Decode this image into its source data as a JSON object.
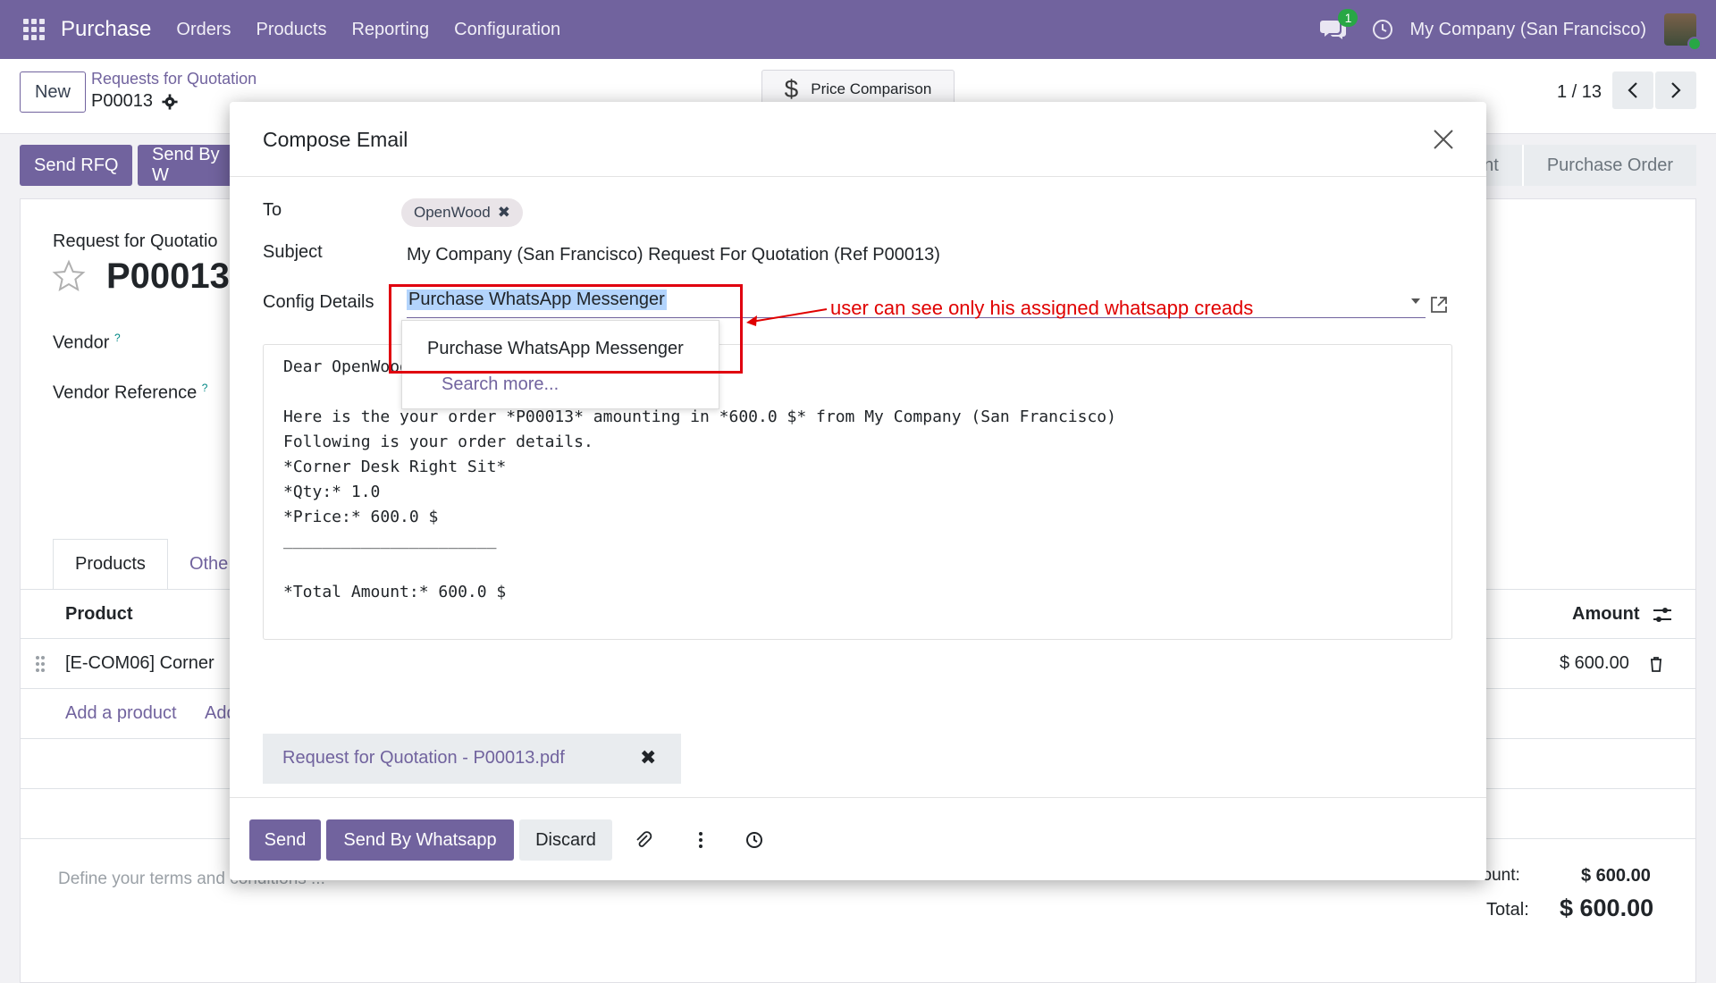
{
  "navbar": {
    "brand": "Purchase",
    "menu": [
      "Orders",
      "Products",
      "Reporting",
      "Configuration"
    ],
    "chat_badge": "1",
    "company": "My Company (San Francisco)"
  },
  "control": {
    "new_label": "New",
    "breadcrumb": "Requests for Quotation",
    "record": "P00013",
    "price_comparison": "Price Comparison",
    "dollar_glyph": "$",
    "pager": "1 / 13"
  },
  "form": {
    "send_rfq": "Send RFQ",
    "send_by": "Send By W",
    "status_left": "nt",
    "status_right": "Purchase Order",
    "label": "Request for Quotatio",
    "id": "P00013",
    "vendor_label": "Vendor",
    "vendor_ref_label": "Vendor Reference",
    "help": "?",
    "tabs": [
      "Products",
      "Othe"
    ],
    "col_product": "Product",
    "col_amount": "Amount",
    "row_product": "[E-COM06] Corner",
    "row_amount": "$ 600.00",
    "add_product": "Add a product",
    "add_section": "Add",
    "terms_placeholder": "Define your terms and conditions ...",
    "untaxed_label": "Untaxed Amount:",
    "untaxed_value": "$ 600.00",
    "total_label": "Total:",
    "total_value": "$ 600.00"
  },
  "modal": {
    "title": "Compose Email",
    "to_label": "To",
    "to_tag": "OpenWood",
    "tag_remove": "✖",
    "subject_label": "Subject",
    "subject": "My Company (San Francisco) Request For Quotation (Ref P00013)",
    "config_label": "Config Details",
    "config_value": "Purchase WhatsApp Messenger",
    "annotation": "user can see only his assigned whatsapp creads",
    "dropdown_item": "Purchase WhatsApp Messenger",
    "dropdown_more": "Search more...",
    "body_lines": [
      "Dear OpenWood",
      "",
      "Here is the your order *P00013* amounting in *600.0 $* from My Company (San Francisco)",
      "Following is your order details.",
      "*Corner Desk Right Sit*",
      "*Qty:* 1.0",
      "*Price:* 600.0 $",
      "______________________",
      "",
      "*Total Amount:* 600.0 $"
    ],
    "attachment": "Request for Quotation - P00013.pdf",
    "attachment_remove": "✖",
    "send": "Send",
    "send_whatsapp": "Send By Whatsapp",
    "discard": "Discard"
  },
  "colors": {
    "brand": "#71639e",
    "annotation": "#e00000",
    "badge": "#28a745"
  },
  "icons": [
    "apps-grid-icon",
    "chat-icon",
    "clock-icon",
    "gear-icon",
    "star-icon",
    "chevron-left-icon",
    "chevron-right-icon",
    "close-icon",
    "external-link-icon",
    "paperclip-icon",
    "kebab-menu-icon",
    "schedule-clock-icon",
    "trash-icon",
    "settings-sliders-icon",
    "drag-handle-icon"
  ]
}
